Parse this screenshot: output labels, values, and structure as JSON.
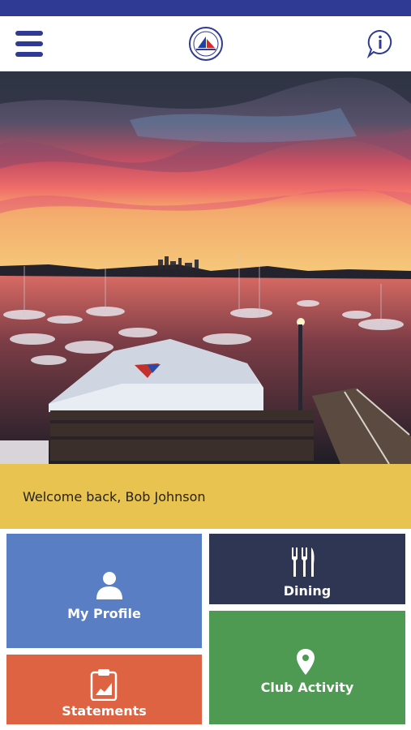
{
  "welcome": {
    "message": "Welcome back, Bob Johnson"
  },
  "tiles": {
    "my_profile": {
      "label": "My Profile",
      "color": "#5a7ec3",
      "icon": "person-icon"
    },
    "dining": {
      "label": "Dining",
      "color": "#2e3654",
      "icon": "fork-knife-icon"
    },
    "club_activity": {
      "label": "Club Activity",
      "color": "#4e9a52",
      "icon": "map-pin-icon"
    },
    "statements": {
      "label": "Statements",
      "color": "#de6343",
      "icon": "clipboard-chart-icon"
    }
  },
  "colors": {
    "brand": "#2f3a94",
    "welcome_bg": "#e8c350"
  }
}
